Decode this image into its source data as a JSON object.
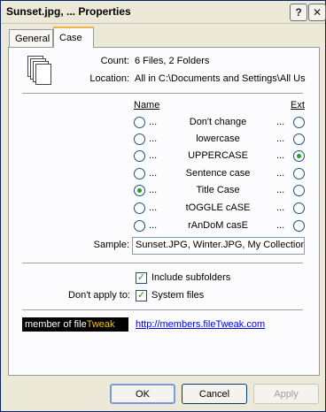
{
  "window": {
    "title": "Sunset.jpg, ... Properties",
    "help_glyph": "?",
    "close_glyph": "✕"
  },
  "tabs": [
    {
      "label": "General",
      "active": false
    },
    {
      "label": "Case",
      "active": true
    }
  ],
  "info": {
    "count_label": "Count:",
    "count_value": "6 Files, 2 Folders",
    "location_label": "Location:",
    "location_value": "All in C:\\Documents and Settings\\All Us"
  },
  "columns": {
    "name_header": "Name",
    "ext_header": "Ext"
  },
  "case_options": [
    {
      "label": "Don't change",
      "dots": "...",
      "name_selected": false,
      "ext_selected": false
    },
    {
      "label": "lowercase",
      "dots": "...",
      "name_selected": false,
      "ext_selected": false
    },
    {
      "label": "UPPERCASE",
      "dots": "...",
      "name_selected": false,
      "ext_selected": true
    },
    {
      "label": "Sentence case",
      "dots": "...",
      "name_selected": false,
      "ext_selected": false
    },
    {
      "label": "Title Case",
      "dots": "...",
      "name_selected": true,
      "ext_selected": false
    },
    {
      "label": "tOGGLE cASE",
      "dots": "...",
      "name_selected": false,
      "ext_selected": false
    },
    {
      "label": "rAnDoM casE",
      "dots": "...",
      "name_selected": false,
      "ext_selected": false
    }
  ],
  "sample": {
    "label": "Sample:",
    "value": "Sunset.JPG, Winter.JPG, My Collection"
  },
  "options": {
    "include_subfolders_label": "Include subfolders",
    "include_subfolders_checked": true,
    "dont_apply_label": "Don't apply to:",
    "system_files_label": "System files",
    "system_files_checked": true
  },
  "banner": {
    "text_prefix": "member of file",
    "text_brand": "Tweak",
    "link": "http://members.fileTweak.com"
  },
  "buttons": {
    "ok": "OK",
    "cancel": "Cancel",
    "apply": "Apply",
    "apply_enabled": false
  },
  "colors": {
    "accent_tab": "#f3b34a",
    "radio_dot": "#21a121",
    "link": "#0000ee"
  }
}
